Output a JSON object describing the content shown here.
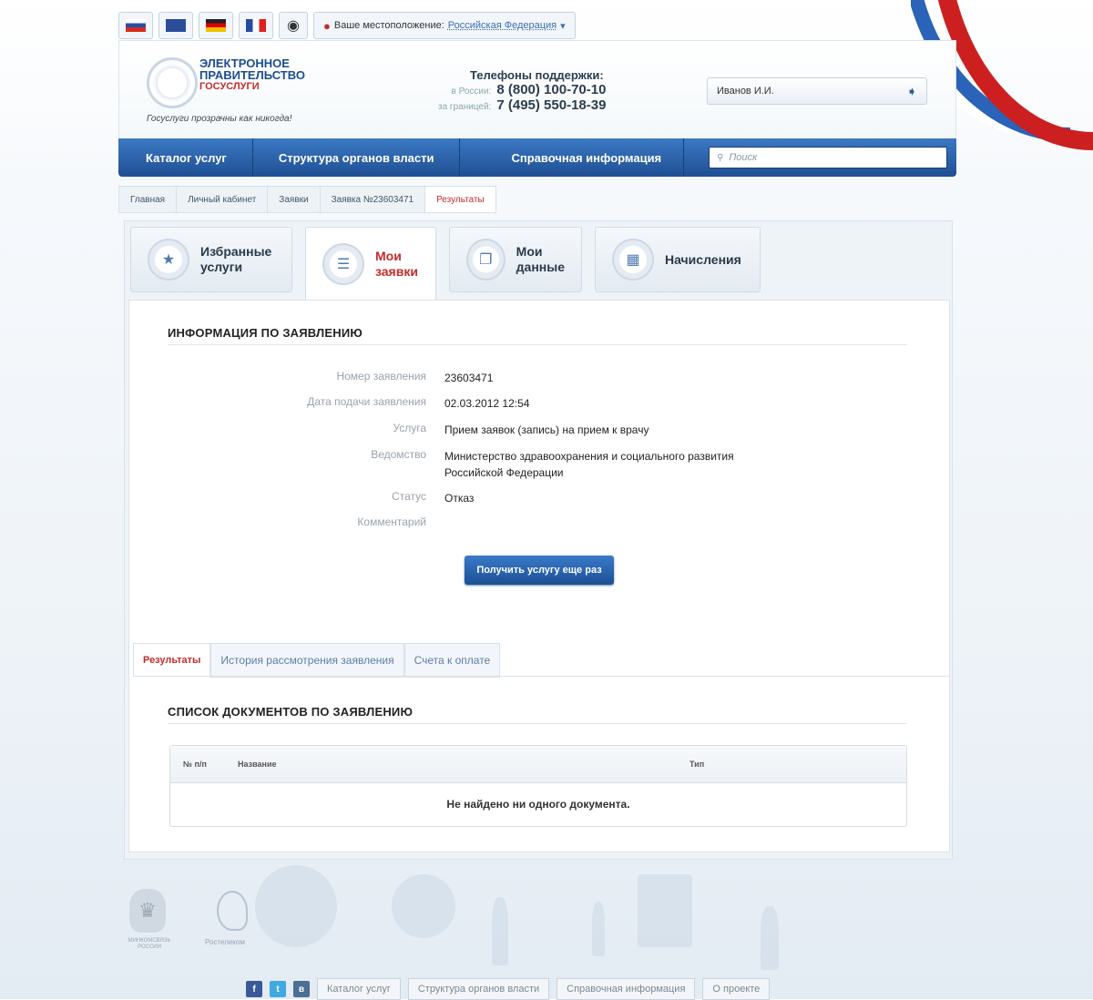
{
  "topbar": {
    "flags": [
      {
        "name": "flag-ru-icon",
        "css": "f-ru"
      },
      {
        "name": "flag-uk-icon",
        "css": "f-uk"
      },
      {
        "name": "flag-de-icon",
        "css": "f-de"
      },
      {
        "name": "flag-fr-icon",
        "css": "f-fr"
      }
    ],
    "location_label": "Ваше местоположение:",
    "location_value": "Российская Федерация"
  },
  "header": {
    "logo_line1": "ЭЛЕКТРОННОЕ",
    "logo_line2": "ПРАВИТЕЛЬСТВО",
    "logo_line3": "ГОСУСЛУГИ",
    "tagline": "Госуслуги прозрачны как никогда!",
    "support_title": "Телефоны поддержки:",
    "phone_russia_label": "в России:",
    "phone_russia": "8 (800) 100-70-10",
    "phone_abroad_label": "за границей:",
    "phone_abroad": "7 (495) 550-18-39",
    "user_name": "Иванов И.И."
  },
  "nav": {
    "items": [
      "Каталог услуг",
      "Структура органов власти",
      "Справочная информация"
    ],
    "search_placeholder": "Поиск"
  },
  "breadcrumb": [
    "Главная",
    "Личный кабинет",
    "Заявки",
    "Заявка №23603471",
    "Результаты"
  ],
  "bigtabs": [
    {
      "line1": "Избранные",
      "line2": "услуги",
      "icon": "star-user-icon"
    },
    {
      "line1": "Мои",
      "line2": "заявки",
      "icon": "list-icon"
    },
    {
      "line1": "Мои",
      "line2": "данные",
      "icon": "folder-icon"
    },
    {
      "line1": "Начисления",
      "line2": "",
      "icon": "calculator-icon"
    }
  ],
  "info": {
    "title": "ИНФОРМАЦИЯ ПО ЗАЯВЛЕНИЮ",
    "rows": [
      {
        "label": "Номер заявления",
        "value": "23603471"
      },
      {
        "label": "Дата подачи заявления",
        "value": "02.03.2012 12:54"
      },
      {
        "label": "Услуга",
        "value": "Прием заявок (запись) на прием к врачу"
      },
      {
        "label": "Ведомство",
        "value": "Министерство здравоохранения и социального развития Российской Федерации"
      },
      {
        "label": "Статус",
        "value": "Отказ"
      },
      {
        "label": "Комментарий",
        "value": ""
      }
    ],
    "button": "Получить услугу еще раз"
  },
  "subtabs": [
    "Результаты",
    "История рассмотрения заявления",
    "Счета к оплате"
  ],
  "documents": {
    "title": "СПИСОК ДОКУМЕНТОВ ПО ЗАЯВЛЕНИЮ",
    "columns": [
      "№ п/п",
      "Название",
      "Тип"
    ],
    "empty_message": "Не найдено ни одного документа."
  },
  "footer": {
    "ministry_caption": "МИНКОМСВЯЗЬ РОССИИ",
    "rt_caption": "Ростелеком",
    "social": [
      {
        "name": "facebook-icon",
        "glyph": "f",
        "color": "#3b5998"
      },
      {
        "name": "twitter-icon",
        "glyph": "t",
        "color": "#3fa9e0"
      },
      {
        "name": "vk-icon",
        "glyph": "в",
        "color": "#4c6f93"
      }
    ],
    "links": [
      "Каталог услуг",
      "Структура органов власти",
      "Справочная информация",
      "О проекте"
    ]
  }
}
